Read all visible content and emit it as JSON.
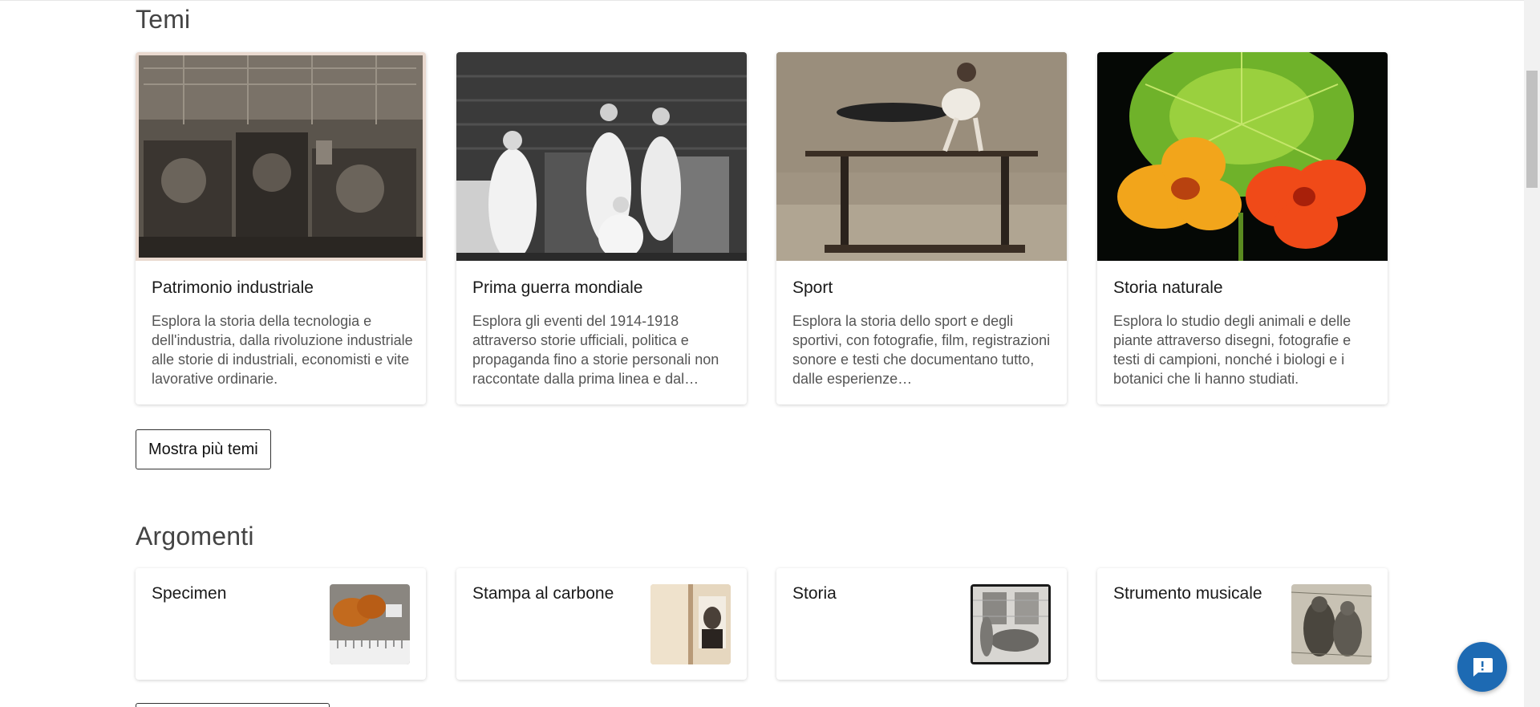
{
  "themes_section": {
    "title": "Temi",
    "cards": [
      {
        "title": "Patrimonio industriale",
        "description": "Esplora la storia della tecnologia e dell'industria, dalla rivoluzione industriale alle storie di industriali, economisti e vite lavorative ordinarie."
      },
      {
        "title": "Prima guerra mondiale",
        "description": "Esplora gli eventi del 1914-1918 attraverso storie ufficiali, politica e propaganda fino a storie personali non raccontate dalla prima linea e dal…"
      },
      {
        "title": "Sport",
        "description": "Esplora la storia dello sport e degli sportivi, con fotografie, film, registrazioni sonore e testi che documentano tutto, dalle esperienze…"
      },
      {
        "title": "Storia naturale",
        "description": "Esplora lo studio degli animali e delle piante attraverso disegni, fotografie e testi di campioni, nonché i biologi e i botanici che li hanno studiati."
      }
    ],
    "more_button": "Mostra più temi"
  },
  "topics_section": {
    "title": "Argomenti",
    "cards": [
      {
        "title": "Specimen"
      },
      {
        "title": "Stampa al carbone"
      },
      {
        "title": "Storia"
      },
      {
        "title": "Strumento musicale"
      }
    ]
  },
  "chat": {
    "icon": "chat-bubble-icon"
  },
  "colors": {
    "accent": "#1d6ab3",
    "text": "#1a1a1a",
    "muted_text": "#555555"
  }
}
